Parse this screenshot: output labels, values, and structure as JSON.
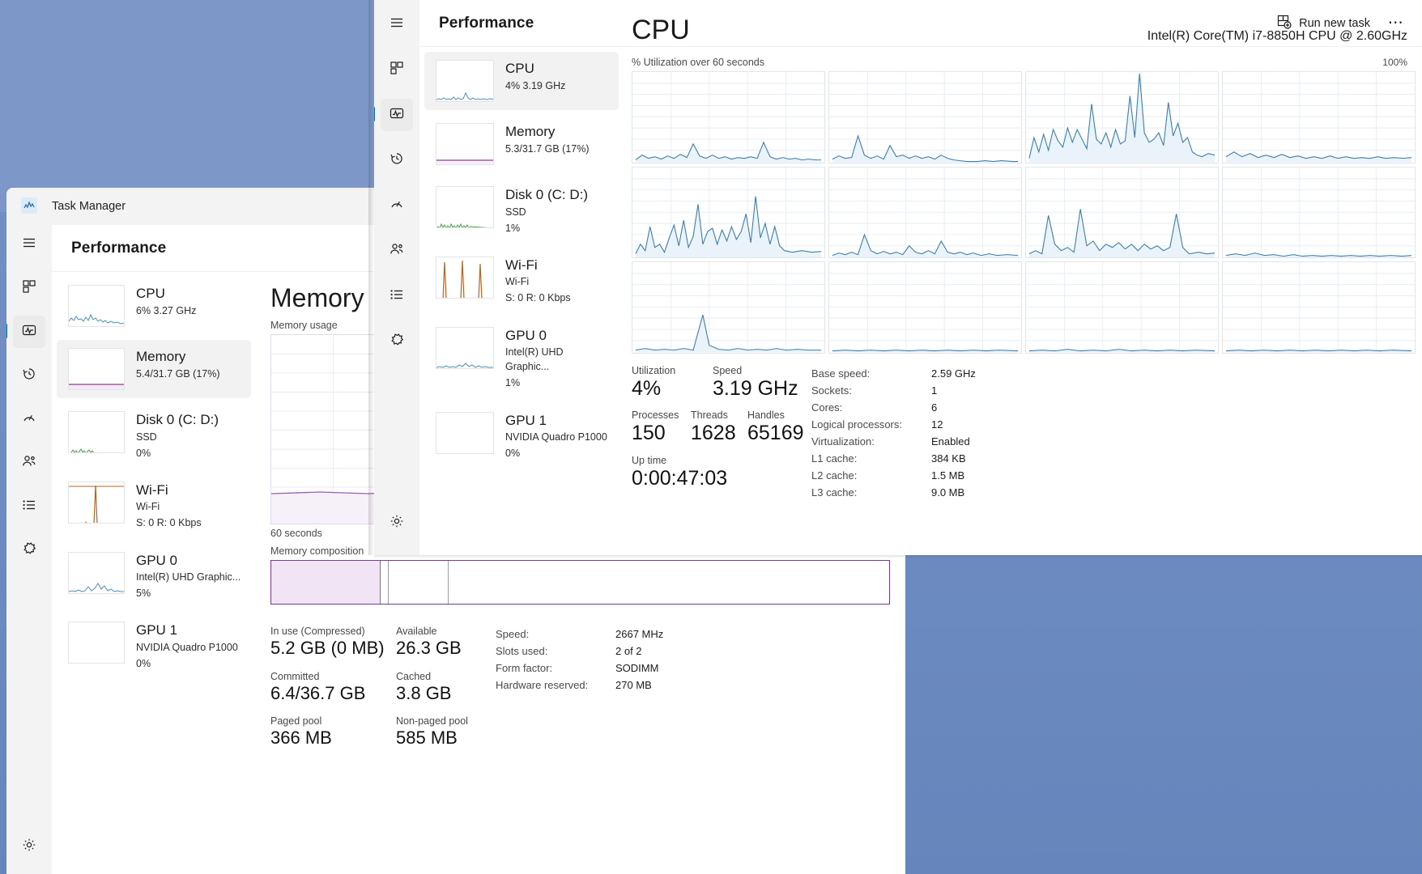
{
  "desktop": {
    "bg_color": "#6d8cc0"
  },
  "background_window": {
    "app_icon_name": "task-manager-icon",
    "title": "Task Manager",
    "page_title": "Performance",
    "rail": [
      {
        "icon": "hamburger-icon",
        "name": "menu"
      },
      {
        "icon": "processes-icon",
        "name": "processes"
      },
      {
        "icon": "performance-icon",
        "name": "performance",
        "active": true
      },
      {
        "icon": "app-history-icon",
        "name": "app-history"
      },
      {
        "icon": "startup-apps-icon",
        "name": "startup-apps"
      },
      {
        "icon": "users-icon",
        "name": "users"
      },
      {
        "icon": "details-icon",
        "name": "details"
      },
      {
        "icon": "services-icon",
        "name": "services"
      },
      {
        "icon": "settings-gear-icon",
        "name": "settings"
      }
    ],
    "resources": [
      {
        "name": "CPU",
        "line1": "6%  3.27 GHz",
        "line2": "",
        "color": "#4a90b8",
        "selected": false
      },
      {
        "name": "Memory",
        "line1": "5.4/31.7 GB (17%)",
        "line2": "",
        "color": "#8b3f8b",
        "selected": true
      },
      {
        "name": "Disk 0 (C: D:)",
        "line1": "SSD",
        "line2": "0%",
        "color": "#4aa04a",
        "selected": false
      },
      {
        "name": "Wi-Fi",
        "line1": "Wi-Fi",
        "line2": "S: 0 R: 0 Kbps",
        "color": "#b5651d",
        "selected": false
      },
      {
        "name": "GPU 0",
        "line1": "Intel(R) UHD Graphic...",
        "line2": "5%",
        "color": "#4a90b8",
        "selected": false
      },
      {
        "name": "GPU 1",
        "line1": "NVIDIA Quadro P1000",
        "line2": "0%",
        "color": "#4a90b8",
        "selected": false
      }
    ],
    "memory": {
      "title": "Memory",
      "graph_label": "Memory usage",
      "graph_footer": "60 seconds",
      "composition_label": "Memory composition",
      "stats": [
        {
          "label": "In use (Compressed)",
          "value": "5.2 GB (0 MB)"
        },
        {
          "label": "Available",
          "value": "26.3 GB"
        },
        {
          "label": "Committed",
          "value": "6.4/36.7 GB"
        },
        {
          "label": "Cached",
          "value": "3.8 GB"
        },
        {
          "label": "Paged pool",
          "value": "366 MB"
        },
        {
          "label": "Non-paged pool",
          "value": "585 MB"
        }
      ],
      "details": [
        {
          "key": "Speed:",
          "value": "2667 MHz"
        },
        {
          "key": "Slots used:",
          "value": "2 of 2"
        },
        {
          "key": "Form factor:",
          "value": "SODIMM"
        },
        {
          "key": "Hardware reserved:",
          "value": "270 MB"
        }
      ]
    }
  },
  "foreground_window": {
    "page_title": "Performance",
    "run_new_task_label": "Run new task",
    "run_new_task_icon": "new-task-icon",
    "more_options_icon": "ellipsis-icon",
    "hamburger_icon": "hamburger-icon",
    "rail": [
      {
        "icon": "hamburger-icon",
        "name": "menu"
      },
      {
        "icon": "processes-icon",
        "name": "processes"
      },
      {
        "icon": "performance-icon",
        "name": "performance",
        "active": true
      },
      {
        "icon": "app-history-icon",
        "name": "app-history"
      },
      {
        "icon": "startup-apps-icon",
        "name": "startup-apps"
      },
      {
        "icon": "users-icon",
        "name": "users"
      },
      {
        "icon": "details-icon",
        "name": "details"
      },
      {
        "icon": "services-icon",
        "name": "services"
      },
      {
        "icon": "settings-gear-icon",
        "name": "settings"
      }
    ],
    "resources": [
      {
        "name": "CPU",
        "line1": "4%  3.19 GHz",
        "line2": "",
        "color": "#4a90b8",
        "selected": true
      },
      {
        "name": "Memory",
        "line1": "5.3/31.7 GB (17%)",
        "line2": "",
        "color": "#8b3f8b",
        "selected": false
      },
      {
        "name": "Disk 0 (C: D:)",
        "line1": "SSD",
        "line2": "1%",
        "color": "#4aa04a",
        "selected": false
      },
      {
        "name": "Wi-Fi",
        "line1": "Wi-Fi",
        "line2": "S: 0 R: 0 Kbps",
        "color": "#b5651d",
        "selected": false
      },
      {
        "name": "GPU 0",
        "line1": "Intel(R) UHD Graphic...",
        "line2": "1%",
        "color": "#4a90b8",
        "selected": false
      },
      {
        "name": "GPU 1",
        "line1": "NVIDIA Quadro P1000",
        "line2": "0%",
        "color": "#4a90b8",
        "selected": false
      }
    ],
    "cpu": {
      "title": "CPU",
      "model": "Intel(R) Core(TM) i7-8850H CPU @ 2.60GHz",
      "graph_caption": "% Utilization over 60 seconds",
      "graph_max": "100%",
      "stats": [
        {
          "label": "Utilization",
          "value": "4%"
        },
        {
          "label": "Speed",
          "value": "3.19 GHz"
        },
        {
          "label": "Processes",
          "value": "150"
        },
        {
          "label": "Threads",
          "value": "1628"
        },
        {
          "label": "Handles",
          "value": "65169"
        },
        {
          "label": "Up time",
          "value": "0:00:47:03"
        }
      ],
      "details": [
        {
          "key": "Base speed:",
          "value": "2.59 GHz"
        },
        {
          "key": "Sockets:",
          "value": "1"
        },
        {
          "key": "Cores:",
          "value": "6"
        },
        {
          "key": "Logical processors:",
          "value": "12"
        },
        {
          "key": "Virtualization:",
          "value": "Enabled"
        },
        {
          "key": "L1 cache:",
          "value": "384 KB"
        },
        {
          "key": "L2 cache:",
          "value": "1.5 MB"
        },
        {
          "key": "L3 cache:",
          "value": "9.0 MB"
        }
      ]
    }
  },
  "chart_data": {
    "type": "line",
    "title": "% Utilization over 60 seconds",
    "ylabel": "% Utilization",
    "xlabel": "60 seconds",
    "ylim": [
      0,
      100
    ],
    "grid": true,
    "legend": "none",
    "accent_color": "#3b7eaa",
    "note": "12 logical-processor sparkline cells, 4 columns x 3 rows",
    "series": [
      {
        "name": "CPU 0",
        "values": [
          3,
          4,
          7,
          4,
          3,
          5,
          4,
          3,
          6,
          5,
          4,
          22,
          6,
          4,
          5,
          4,
          8,
          4,
          3,
          6,
          4,
          3,
          4,
          5,
          4,
          3,
          4,
          3,
          4,
          3,
          4,
          24,
          5,
          3,
          4,
          3
        ]
      },
      {
        "name": "CPU 1",
        "values": [
          4,
          3,
          9,
          4,
          3,
          30,
          6,
          4,
          3,
          5,
          14,
          4,
          6,
          4,
          6,
          5,
          4,
          6,
          4,
          3,
          2,
          1,
          0,
          0,
          0,
          2,
          1,
          0,
          1,
          2,
          1,
          0,
          1,
          0,
          1,
          0
        ]
      },
      {
        "name": "CPU 2",
        "values": [
          14,
          6,
          26,
          10,
          8,
          26,
          12,
          30,
          54,
          14,
          30,
          18,
          24,
          10,
          36,
          16,
          22,
          90,
          20,
          16,
          20,
          14,
          54,
          22,
          30,
          18,
          12,
          8,
          6,
          4,
          3,
          8,
          6,
          5,
          4,
          6
        ]
      },
      {
        "name": "CPU 3",
        "values": [
          3,
          5,
          4,
          6,
          5,
          4,
          6,
          3,
          5,
          4,
          6,
          4,
          5,
          3,
          4,
          5,
          4,
          3,
          5,
          4,
          3,
          5,
          4,
          3,
          4,
          5,
          4,
          3,
          4,
          5,
          4,
          3,
          5,
          4,
          3,
          4
        ]
      },
      {
        "name": "CPU 4",
        "values": [
          4,
          12,
          6,
          4,
          18,
          10,
          24,
          8,
          16,
          10,
          40,
          6,
          20,
          14,
          12,
          18,
          10,
          14,
          20,
          12,
          44,
          8,
          16,
          10,
          14,
          6,
          4,
          3,
          2,
          3,
          2,
          3,
          2,
          3,
          2,
          3
        ]
      },
      {
        "name": "CPU 5",
        "values": [
          3,
          4,
          3,
          5,
          4,
          3,
          12,
          4,
          3,
          5,
          4,
          6,
          10,
          4,
          3,
          5,
          4,
          8,
          4,
          3,
          5,
          4,
          3,
          4,
          3,
          2,
          1,
          2,
          1,
          2,
          1,
          2,
          1,
          2,
          1,
          2
        ]
      },
      {
        "name": "CPU 6",
        "values": [
          2,
          3,
          4,
          3,
          20,
          4,
          3,
          5,
          4,
          3,
          24,
          6,
          4,
          5,
          8,
          4,
          6,
          5,
          4,
          6,
          8,
          4,
          5,
          4,
          18,
          4,
          3,
          2,
          3,
          2,
          3,
          2,
          3,
          2,
          3,
          2
        ]
      },
      {
        "name": "CPU 7",
        "values": [
          2,
          3,
          2,
          3,
          4,
          3,
          2,
          3,
          4,
          3,
          2,
          3,
          4,
          3,
          2,
          3,
          4,
          3,
          2,
          3,
          4,
          3,
          2,
          3,
          4,
          3,
          2,
          3,
          4,
          3,
          2,
          3,
          4,
          3,
          2,
          3
        ]
      },
      {
        "name": "CPU 8",
        "values": [
          2,
          3,
          2,
          3,
          4,
          3,
          18,
          3,
          4,
          3,
          2,
          3,
          4,
          3,
          2,
          3,
          4,
          3,
          2,
          3,
          4,
          3,
          2,
          3,
          4,
          3,
          2,
          3,
          4,
          3,
          2,
          3,
          4,
          3,
          2,
          3
        ]
      },
      {
        "name": "CPU 9",
        "values": [
          2,
          3,
          2,
          3,
          4,
          3,
          2,
          3,
          4,
          3,
          2,
          3,
          4,
          3,
          2,
          3,
          4,
          3,
          2,
          3,
          4,
          3,
          2,
          3,
          4,
          3,
          2,
          3,
          4,
          3,
          2,
          3,
          4,
          3,
          2,
          3
        ]
      },
      {
        "name": "CPU 10",
        "values": [
          2,
          3,
          2,
          3,
          4,
          3,
          2,
          3,
          4,
          3,
          2,
          3,
          4,
          3,
          2,
          3,
          4,
          3,
          2,
          3,
          4,
          3,
          2,
          3,
          4,
          3,
          2,
          3,
          4,
          3,
          2,
          3,
          4,
          3,
          2,
          3
        ]
      },
      {
        "name": "CPU 11",
        "values": [
          2,
          3,
          2,
          3,
          4,
          3,
          2,
          3,
          4,
          3,
          2,
          3,
          4,
          3,
          2,
          3,
          4,
          3,
          2,
          3,
          4,
          3,
          2,
          3,
          4,
          3,
          2,
          3,
          4,
          3,
          2,
          3,
          4,
          3,
          2,
          3
        ]
      }
    ]
  }
}
